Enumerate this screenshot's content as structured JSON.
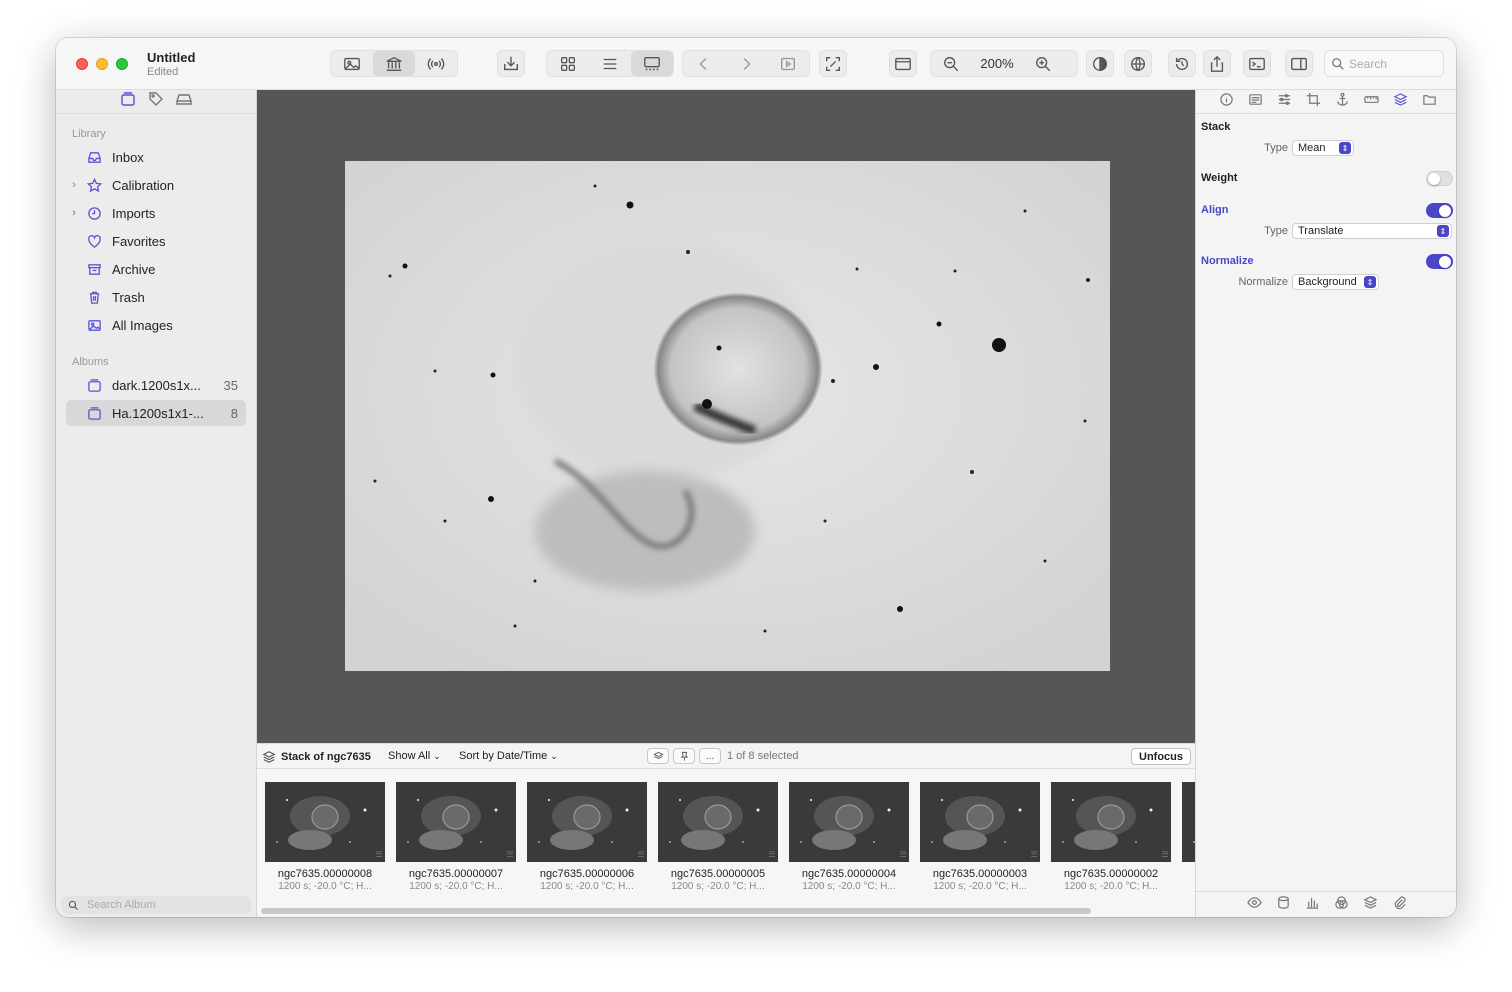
{
  "window": {
    "title": "Untitled",
    "subtitle": "Edited"
  },
  "toolbar": {
    "zoom_level": "200%",
    "search_placeholder": "Search"
  },
  "sidebar": {
    "library_label": "Library",
    "albums_label": "Albums",
    "library_items": [
      {
        "label": "Inbox",
        "icon": "inbox-icon",
        "expandable": false
      },
      {
        "label": "Calibration",
        "icon": "star-icon",
        "expandable": true
      },
      {
        "label": "Imports",
        "icon": "clock-icon",
        "expandable": true
      },
      {
        "label": "Favorites",
        "icon": "heart-icon",
        "expandable": false
      },
      {
        "label": "Archive",
        "icon": "archive-icon",
        "expandable": false
      },
      {
        "label": "Trash",
        "icon": "trash-icon",
        "expandable": false
      },
      {
        "label": "All Images",
        "icon": "images-icon",
        "expandable": false
      }
    ],
    "albums": [
      {
        "label": "dark.1200s1x...",
        "count": "35",
        "selected": false
      },
      {
        "label": "Ha.1200s1x1-...",
        "count": "8",
        "selected": true
      }
    ],
    "search_placeholder": "Search Album"
  },
  "strip": {
    "stack_title": "Stack of ngc7635",
    "show_all": "Show All",
    "sort": "Sort by Date/Time",
    "more_label": "...",
    "selection": "1 of 8 selected",
    "unfocus": "Unfocus"
  },
  "thumbnails": [
    {
      "name": "ngc7635.00000008",
      "meta": "1200 s; -20.0 °C; H..."
    },
    {
      "name": "ngc7635.00000007",
      "meta": "1200 s; -20.0 °C; H..."
    },
    {
      "name": "ngc7635.00000006",
      "meta": "1200 s; -20.0 °C; H..."
    },
    {
      "name": "ngc7635.00000005",
      "meta": "1200 s; -20.0 °C; H..."
    },
    {
      "name": "ngc7635.00000004",
      "meta": "1200 s; -20.0 °C; H..."
    },
    {
      "name": "ngc7635.00000003",
      "meta": "1200 s; -20.0 °C; H..."
    },
    {
      "name": "ngc7635.00000002",
      "meta": "1200 s; -20.0 °C; H..."
    },
    {
      "name": "n",
      "meta": "12"
    }
  ],
  "inspector": {
    "stack_label": "Stack",
    "stack_type_label": "Type",
    "stack_type_value": "Mean",
    "weight_label": "Weight",
    "weight_on": false,
    "align_label": "Align",
    "align_on": true,
    "align_type_label": "Type",
    "align_type_value": "Translate",
    "normalize_label": "Normalize",
    "normalize_on": true,
    "normalize_field_label": "Normalize",
    "normalize_value": "Background"
  },
  "colors": {
    "accent": "#4b46c8",
    "viewer_bg": "#565656"
  }
}
